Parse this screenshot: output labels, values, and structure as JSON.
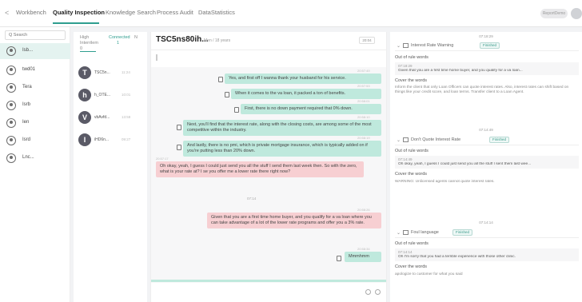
{
  "nav": {
    "back_icon": "back-icon",
    "tabs": [
      {
        "label": "Workbench",
        "active": false
      },
      {
        "label": "Quality Inspection",
        "active": true
      },
      {
        "label": "Knowledge Search",
        "active": false
      },
      {
        "label": "Process Audit",
        "active": false
      },
      {
        "label": "DataStatistics",
        "active": false
      }
    ],
    "report_label": "ReportDemo",
    "accent_color": "#2f9e8f"
  },
  "left": {
    "search_placeholder": "Q Search",
    "users": [
      {
        "label": "Isb...",
        "selected": true
      },
      {
        "label": "twd01",
        "selected": false
      },
      {
        "label": "Tera",
        "selected": false
      },
      {
        "label": "Isrb",
        "selected": false
      },
      {
        "label": "Ien",
        "selected": false
      },
      {
        "label": "Isrd",
        "selected": false
      },
      {
        "label": "Lnc...",
        "selected": false
      }
    ]
  },
  "list": {
    "tab_high": "High Interrilem",
    "tab_count": "0",
    "tab_connected": "Connected",
    "tab_connected_count": "1",
    "tab_more": "N",
    "items": [
      {
        "initial": "T",
        "name": "TSC5n...",
        "time": "11:24"
      },
      {
        "initial": "h",
        "name": "h_OTE...",
        "time": "10:01"
      },
      {
        "initial": "V",
        "name": "vbAvfd...",
        "time": "13:58"
      },
      {
        "initial": "I",
        "name": "iHD6n...",
        "time": "09:27"
      }
    ]
  },
  "chat": {
    "title": "TSC5ns80ih...",
    "meta": "Men / 18 years",
    "date_btn": "20:04",
    "marker": "07:14",
    "messages": [
      {
        "side": "right",
        "color": "green",
        "time": "20:57:49",
        "text": "Yes, and first off I wanna thank your husband for his service."
      },
      {
        "side": "right",
        "color": "green",
        "time": "20:57:53",
        "text": "When it comes to the va loan, it packed a ton of benefits."
      },
      {
        "side": "right",
        "color": "green",
        "time": "20:58:01",
        "text": "First, there is no down payment required that 0% down."
      },
      {
        "side": "right",
        "color": "green",
        "time": "20:58:10",
        "text": "Next, you'll find that the interest rate, along with the closing costs, are among some of the most competitive within the industry."
      },
      {
        "side": "right",
        "color": "green",
        "time": "20:58:19",
        "text": "And lastly, there is no pmi, which is private mortgage insurance, which is typically added on if you're putting less than 20% down."
      },
      {
        "side": "left",
        "color": "red",
        "time": "20:57:17",
        "text": "Oh okay, yeah, I guess I could just send you all the stuff I send them last week then. So with the zero, what is your rate at? I se you offer me a lower rate there right now?"
      },
      {
        "side": "right",
        "color": "red",
        "time": "20:58:26",
        "text": "Given that you are a first time home buyer, and you qualify for a va loan where you can take advantage of a lot of the lower rate programs and offer you a 3% rate."
      },
      {
        "side": "right",
        "color": "green",
        "time": "20:58:34",
        "text": "Mmmhmm"
      }
    ]
  },
  "rules": {
    "sections": [
      {
        "timestamp": "07:18:29",
        "name": "Interest Rate Warning",
        "status": "Finished",
        "out_label": "Out of rule words",
        "entry_time": "07:18:29",
        "entry_text": "Given that you are a first time home buyer, and you qualify for a va loan...",
        "cover_label": "Cover the words",
        "cover_text": "Inform the client that only Loan Officers can quote interest rates. Also, interest rates can shift based on things like your credit score, and loan terms. Transfer client to a Loan Agent."
      },
      {
        "timestamp": "07:14:49",
        "name": "Don't Quote Interest Rate",
        "status": "Finished",
        "out_label": "Out of rule words",
        "entry_time": "07:14:49",
        "entry_text": "Oh okay, yeah, I guess I could just send you all the stuff I sent them last wee...",
        "cover_label": "Cover the words",
        "cover_text": "WARNING: Unlicensed agents cannot quote interest rates."
      },
      {
        "timestamp": "07:14:14",
        "name": "Foul language",
        "status": "Finished",
        "out_label": "Out of rule words",
        "entry_time": "07:14:14",
        "entry_text": "Oh I'm sorry that you had a terrible experience with those other clinic.",
        "cover_label": "Cover the words",
        "cover_text": "apologize to customer for what you said"
      }
    ]
  }
}
